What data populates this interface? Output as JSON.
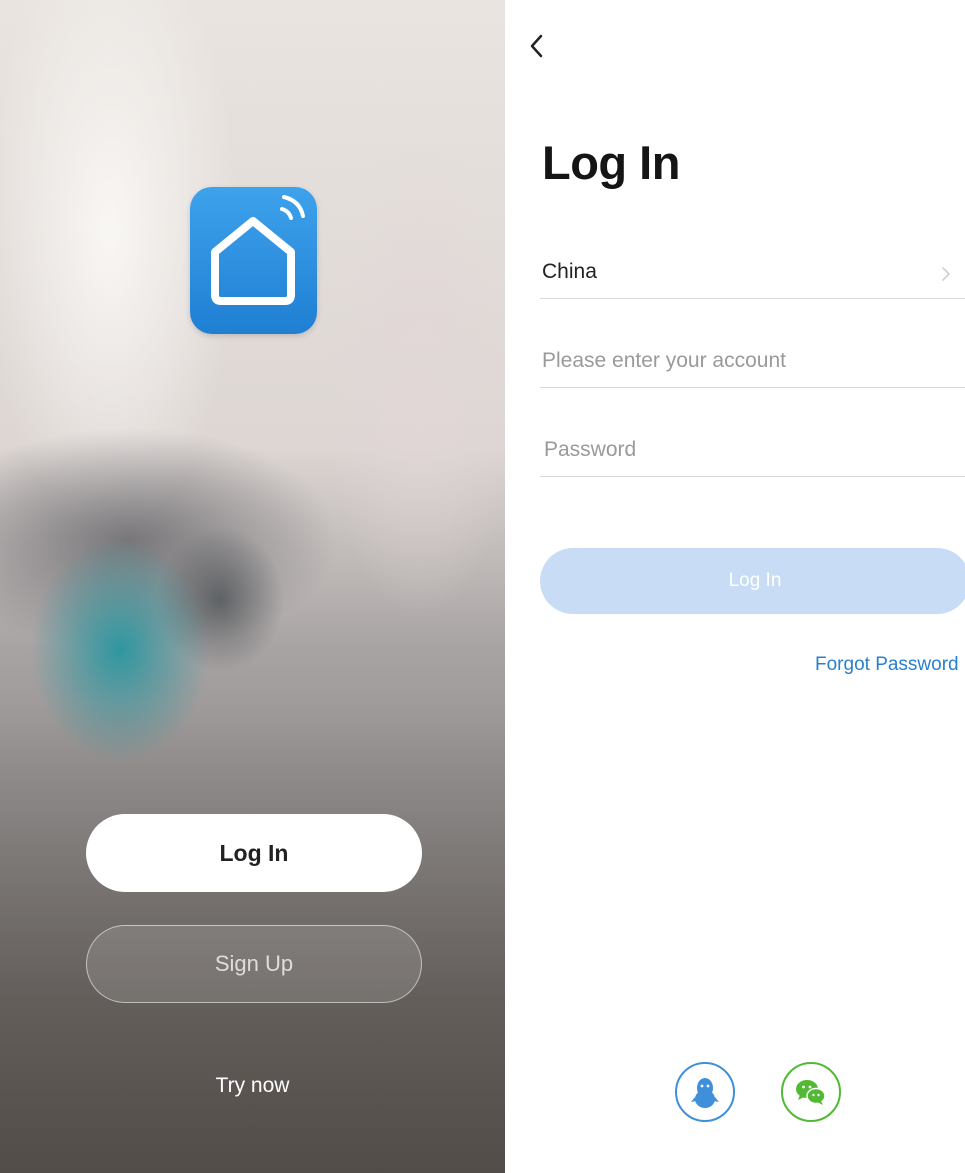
{
  "splash": {
    "app_icon": "smart-home-wifi-icon",
    "login_button": "Log In",
    "signup_button": "Sign Up",
    "try_now": "Try now"
  },
  "login": {
    "back_icon": "chevron-left-icon",
    "title": "Log In",
    "country": "China",
    "account_placeholder": "Please enter your account",
    "password_placeholder": "Password",
    "login_button": "Log In",
    "forgot_password": "Forgot Password",
    "social": [
      {
        "name": "QQ",
        "icon": "qq-penguin-icon",
        "color": "#3f8fdb"
      },
      {
        "name": "WeChat",
        "icon": "wechat-icon",
        "color": "#52b934"
      }
    ]
  },
  "colors": {
    "accent_blue": "#2a80d0",
    "app_icon_blue": "#2a8de0",
    "disabled_button": "#c8dcf5"
  }
}
